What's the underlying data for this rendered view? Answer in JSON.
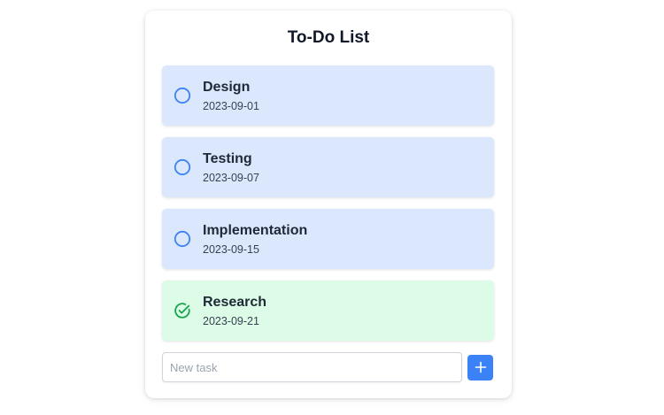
{
  "app": {
    "title": "To-Do List"
  },
  "colors": {
    "pending_bg": "#dbe7fd",
    "done_bg": "#dcfce7",
    "pending_icon": "#3b82f6",
    "done_icon": "#16a34a",
    "accent": "#3b82f6"
  },
  "tasks": [
    {
      "name": "Design",
      "date": "2023-09-01",
      "status": "pending",
      "icon": "circle-icon"
    },
    {
      "name": "Testing",
      "date": "2023-09-07",
      "status": "pending",
      "icon": "circle-icon"
    },
    {
      "name": "Implementation",
      "date": "2023-09-15",
      "status": "pending",
      "icon": "circle-icon"
    },
    {
      "name": "Research",
      "date": "2023-09-21",
      "status": "done",
      "icon": "check-circle-icon"
    }
  ],
  "new_task": {
    "placeholder": "New task",
    "value": "",
    "button_icon": "plus-icon"
  }
}
